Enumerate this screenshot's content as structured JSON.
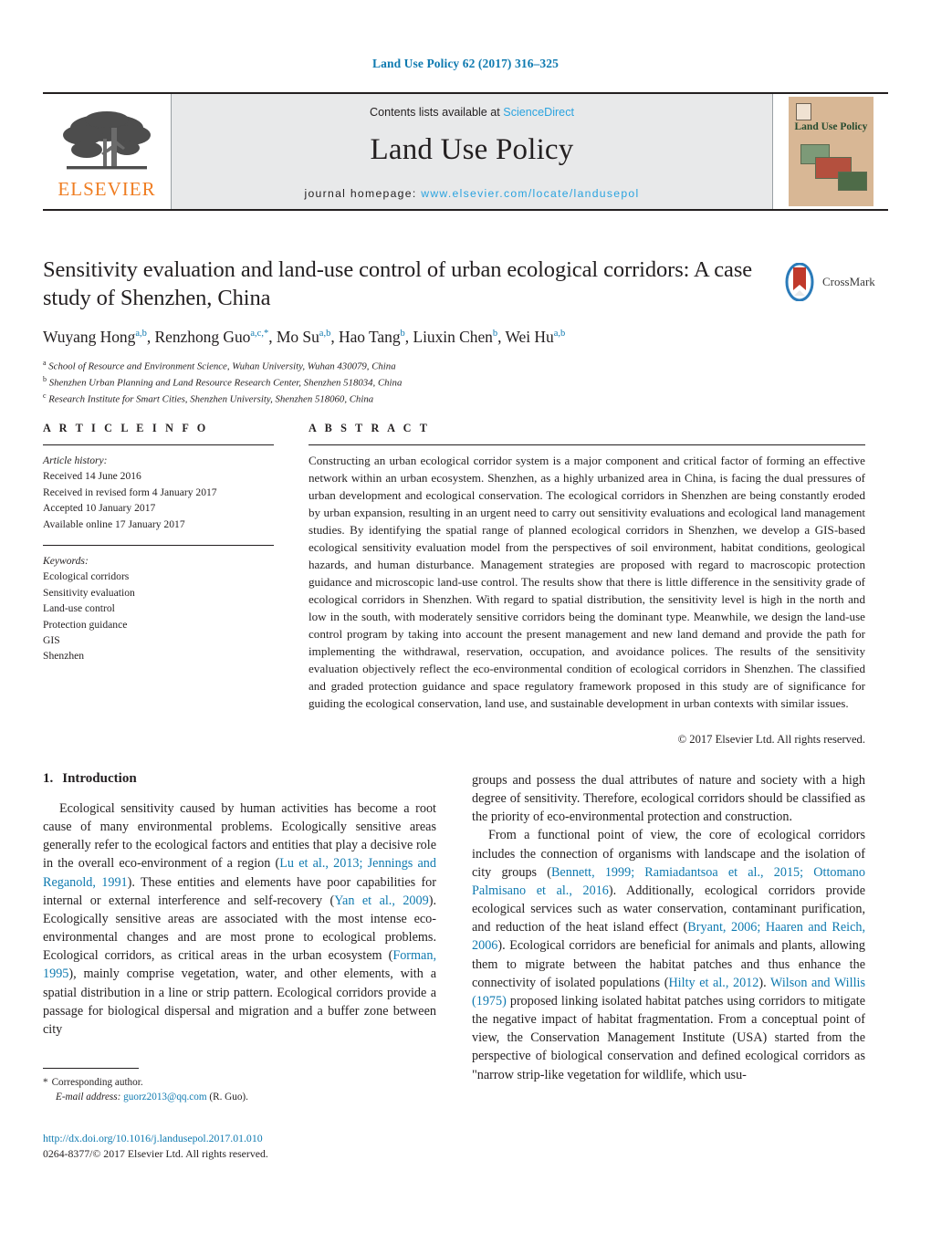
{
  "running_head": "Land Use Policy 62 (2017) 316–325",
  "masthead": {
    "publisher_name": "ELSEVIER",
    "contents_prefix": "Contents lists available at ",
    "contents_link": "ScienceDirect",
    "journal_title": "Land Use Policy",
    "homepage_prefix": "journal homepage: ",
    "homepage_url": "www.elsevier.com/locate/landusepol",
    "cover_title": "Land Use Policy"
  },
  "article": {
    "title": "Sensitivity evaluation and land-use control of urban ecological corridors: A case study of Shenzhen, China",
    "crossmark_label": "CrossMark",
    "authors_html": "Wuyang Hong<sup>a,b</sup>, Renzhong Guo<sup>a,c,</sup><sup>*</sup>, Mo Su<sup>a,b</sup>, Hao Tang<sup>b</sup>, Liuxin Chen<sup>b</sup>, Wei Hu<sup>a,b</sup>",
    "affiliations": [
      {
        "marker": "a",
        "text": "School of Resource and Environment Science, Wuhan University, Wuhan 430079, China"
      },
      {
        "marker": "b",
        "text": "Shenzhen Urban Planning and Land Resource Research Center, Shenzhen 518034, China"
      },
      {
        "marker": "c",
        "text": "Research Institute for Smart Cities, Shenzhen University, Shenzhen 518060, China"
      }
    ]
  },
  "article_info": {
    "heading": "A R T I C L E    I N F O",
    "history_label": "Article history:",
    "history": [
      "Received 14 June 2016",
      "Received in revised form 4 January 2017",
      "Accepted 10 January 2017",
      "Available online 17 January 2017"
    ],
    "keywords_label": "Keywords:",
    "keywords": [
      "Ecological corridors",
      "Sensitivity evaluation",
      "Land-use control",
      "Protection guidance",
      "GIS",
      "Shenzhen"
    ]
  },
  "abstract": {
    "heading": "A B S T R A C T",
    "text": "Constructing an urban ecological corridor system is a major component and critical factor of forming an effective network within an urban ecosystem. Shenzhen, as a highly urbanized area in China, is facing the dual pressures of urban development and ecological conservation. The ecological corridors in Shenzhen are being constantly eroded by urban expansion, resulting in an urgent need to carry out sensitivity evaluations and ecological land management studies. By identifying the spatial range of planned ecological corridors in Shenzhen, we develop a GIS-based ecological sensitivity evaluation model from the perspectives of soil environment, habitat conditions, geological hazards, and human disturbance. Management strategies are proposed with regard to macroscopic protection guidance and microscopic land-use control. The results show that there is little difference in the sensitivity grade of ecological corridors in Shenzhen. With regard to spatial distribution, the sensitivity level is high in the north and low in the south, with moderately sensitive corridors being the dominant type. Meanwhile, we design the land-use control program by taking into account the present management and new land demand and provide the path for implementing the withdrawal, reservation, occupation, and avoidance polices. The results of the sensitivity evaluation objectively reflect the eco-environmental condition of ecological corridors in Shenzhen. The classified and graded protection guidance and space regulatory framework proposed in this study are of significance for guiding the ecological conservation, land use, and sustainable development in urban contexts with similar issues.",
    "copyright": "© 2017 Elsevier Ltd. All rights reserved."
  },
  "body": {
    "section_number": "1.",
    "section_title": "Introduction",
    "left_paragraph_1_parts": [
      {
        "t": "Ecological sensitivity caused by human activities has become a root cause of many environmental problems. Ecologically sensitive areas generally refer to the ecological factors and entities that play a decisive role in the overall eco-environment of a region (",
        "ref": false
      },
      {
        "t": "Lu et al., 2013; Jennings and Reganold, 1991",
        "ref": true
      },
      {
        "t": "). These entities and elements have poor capabilities for internal or external interference and self-recovery (",
        "ref": false
      },
      {
        "t": "Yan et al., 2009",
        "ref": true
      },
      {
        "t": "). Ecologically sensitive areas are associated with the most intense eco-environmental changes and are most prone to ecological problems. Ecological corridors, as critical areas in the urban ecosystem (",
        "ref": false
      },
      {
        "t": "Forman, 1995",
        "ref": true
      },
      {
        "t": "), mainly comprise vegetation, water, and other elements, with a spatial distribution in a line or strip pattern. Ecological corridors provide a passage for biological dispersal and migration and a buffer zone between city",
        "ref": false
      }
    ],
    "right_paragraph_1_parts": [
      {
        "t": "groups and possess the dual attributes of nature and society with a high degree of sensitivity. Therefore, ecological corridors should be classified as the priority of eco-environmental protection and construction.",
        "ref": false
      }
    ],
    "right_paragraph_2_parts": [
      {
        "t": "From a functional point of view, the core of ecological corridors includes the connection of organisms with landscape and the isolation of city groups (",
        "ref": false
      },
      {
        "t": "Bennett, 1999; Ramiadantsoa et al., 2015; Ottomano Palmisano et al., 2016",
        "ref": true
      },
      {
        "t": "). Additionally, ecological corridors provide ecological services such as water conservation, contaminant purification, and reduction of the heat island effect (",
        "ref": false
      },
      {
        "t": "Bryant, 2006; Haaren and Reich, 2006",
        "ref": true
      },
      {
        "t": "). Ecological corridors are beneficial for animals and plants, allowing them to migrate between the habitat patches and thus enhance the connectivity of isolated populations (",
        "ref": false
      },
      {
        "t": "Hilty et al., 2012",
        "ref": true
      },
      {
        "t": "). ",
        "ref": false
      },
      {
        "t": "Wilson and Willis (1975)",
        "ref": true
      },
      {
        "t": " proposed linking isolated habitat patches using corridors to mitigate the negative impact of habitat fragmentation. From a conceptual point of view, the Conservation Management Institute (USA) started from the perspective of biological conservation and defined ecological corridors as \"narrow strip-like vegetation for wildlife, which usu-",
        "ref": false
      }
    ]
  },
  "footnote": {
    "corresponding_label": "Corresponding author.",
    "email_label": "E-mail address:",
    "email": "guorz2013@qq.com",
    "email_suffix": "(R. Guo).",
    "doi": "http://dx.doi.org/10.1016/j.landusepol.2017.01.010",
    "issn_line": "0264-8377/© 2017 Elsevier Ltd. All rights reserved."
  },
  "colors": {
    "link": "#0f7ab0",
    "sciencedirect": "#2aa3df",
    "elsevier_orange": "#ef7d22",
    "masthead_bg": "#e8e9ea",
    "cover_bg": "#d8b795"
  }
}
